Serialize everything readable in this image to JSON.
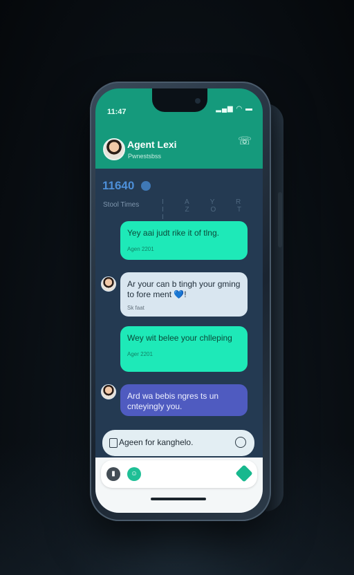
{
  "status_bar": {
    "time": "11:47",
    "icons": "signal wifi battery"
  },
  "header": {
    "agent_name": "Agent Lexi",
    "agent_status": "Pwnestsbss",
    "call_icon": "phone-call-icon"
  },
  "summary": {
    "number": "11640",
    "sub_label": "Stool Times",
    "ticks": "I A Y R I Z O T I"
  },
  "messages": [
    {
      "text": "Yey aai judt rike it of tlng.",
      "meta": "Agen 2201",
      "sender": "user"
    },
    {
      "text": "Ar your can b tingh your gming to fore ment 💙!",
      "meta": "Sk faat",
      "sender": "agent"
    },
    {
      "text": "Wey wit belee your chlleping",
      "meta": "Ager 2201",
      "sender": "user"
    },
    {
      "text": "Ard wa bebis ngres ts un cnteyingly you.",
      "meta": "",
      "sender": "agent"
    }
  ],
  "input": {
    "text": "Ageen for kanghelo.",
    "icon": "attachment-icon",
    "emoji_icon": "emoji-icon"
  },
  "toolbar": {
    "mic_icon": "mic-icon",
    "sticker_icon": "sticker-icon",
    "send_icon": "send-icon"
  },
  "colors": {
    "header": "#159a7c",
    "bubble_user": "#1ee9b8",
    "bubble_agent": "#d9e6f0",
    "bubble_agent_alt": "#4f5bc0",
    "screen_bg": "#243a52"
  }
}
